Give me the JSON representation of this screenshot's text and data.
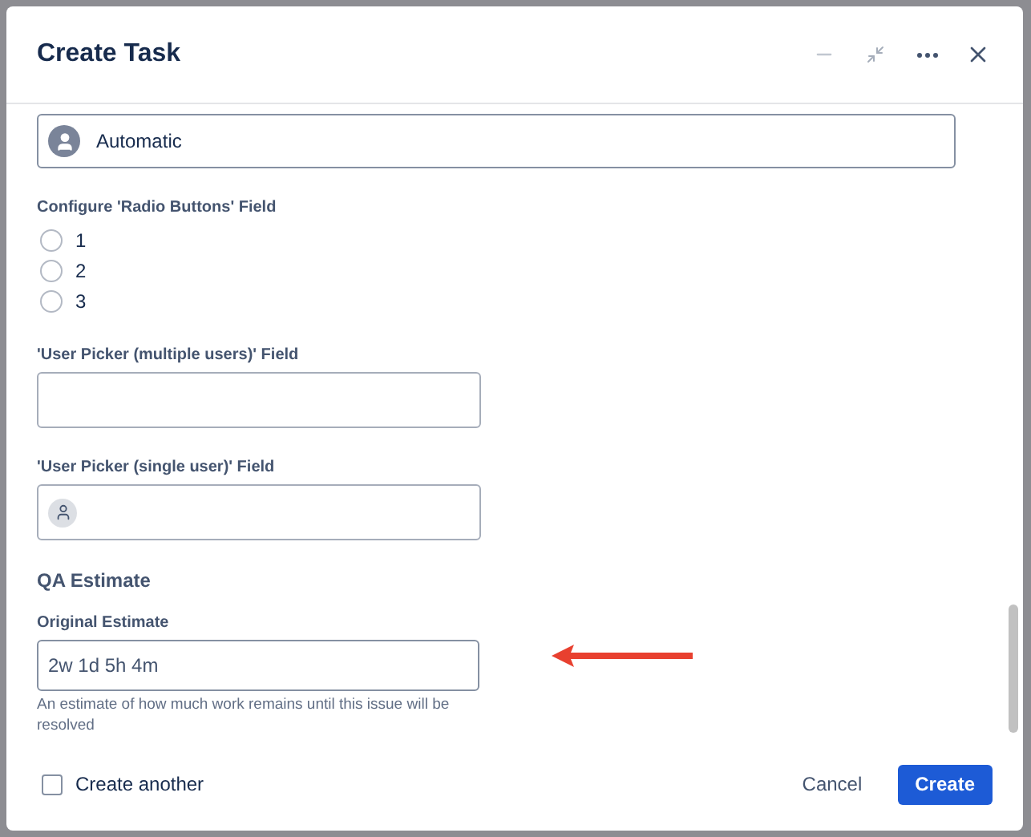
{
  "dialog": {
    "title": "Create Task"
  },
  "assignee": {
    "value": "Automatic"
  },
  "radio_group": {
    "label": "Configure 'Radio Buttons' Field",
    "options": [
      {
        "label": "1",
        "selected": false
      },
      {
        "label": "2",
        "selected": false
      },
      {
        "label": "3",
        "selected": false
      }
    ]
  },
  "multi_user_picker": {
    "label": "'User Picker (multiple users)' Field"
  },
  "single_user_picker": {
    "label": "'User Picker (single user)' Field"
  },
  "section": {
    "title": "QA Estimate"
  },
  "original_estimate": {
    "label": "Original Estimate",
    "value": "2w 1d 5h 4m",
    "help": "An estimate of how much work remains until this issue will be resolved"
  },
  "footer": {
    "create_another": {
      "label": "Create another",
      "checked": false
    },
    "cancel": "Cancel",
    "create": "Create"
  }
}
